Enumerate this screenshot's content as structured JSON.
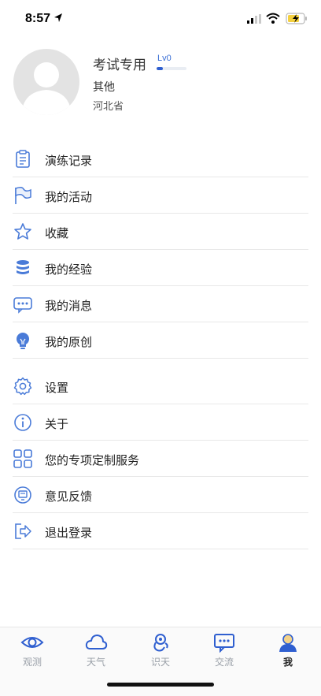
{
  "status_bar": {
    "time": "8:57"
  },
  "profile": {
    "name": "考试专用",
    "level": "Lv0",
    "level_progress": 0.2,
    "role": "其他",
    "region": "河北省"
  },
  "menu_group_1": [
    {
      "label": "演练记录",
      "icon": "clipboard-icon"
    },
    {
      "label": "我的活动",
      "icon": "flag-icon"
    },
    {
      "label": "收藏",
      "icon": "star-icon"
    },
    {
      "label": "我的经验",
      "icon": "coin-stack-icon"
    },
    {
      "label": "我的消息",
      "icon": "message-icon"
    },
    {
      "label": "我的原创",
      "icon": "lightbulb-icon"
    }
  ],
  "menu_group_2": [
    {
      "label": "设置",
      "icon": "gear-icon"
    },
    {
      "label": "关于",
      "icon": "info-icon"
    },
    {
      "label": "您的专项定制服务",
      "icon": "grid-icon"
    },
    {
      "label": "意见反馈",
      "icon": "feedback-icon"
    },
    {
      "label": "退出登录",
      "icon": "logout-icon"
    }
  ],
  "tabs": [
    {
      "label": "观测",
      "icon": "eye-icon"
    },
    {
      "label": "天气",
      "icon": "cloud-icon"
    },
    {
      "label": "识天",
      "icon": "recognize-icon"
    },
    {
      "label": "交流",
      "icon": "chat-icon"
    },
    {
      "label": "我",
      "icon": "user-icon",
      "active": true
    }
  ],
  "colors": {
    "accent": "#2f5fd0",
    "icon_blue": "#4a7bd8",
    "battery": "#f4d03f"
  }
}
